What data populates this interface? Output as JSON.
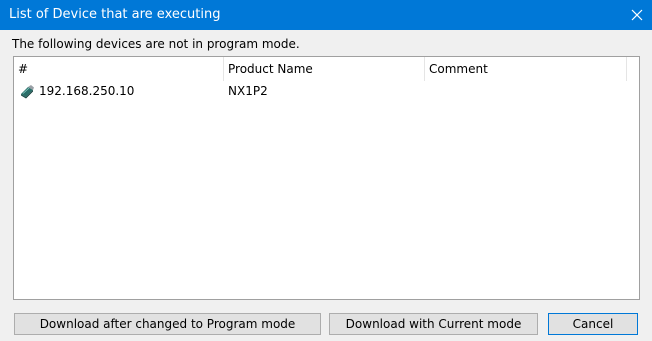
{
  "window": {
    "title": "List of Device that are executing",
    "close_icon": "close-icon"
  },
  "message": "The following devices are not in program mode.",
  "list": {
    "columns": [
      "#",
      "Product Name",
      "Comment"
    ],
    "rows": [
      {
        "icon": "device-icon",
        "address": "192.168.250.10",
        "product_name": "NX1P2",
        "comment": ""
      }
    ]
  },
  "buttons": {
    "download_program_mode": "Download after changed to Program mode",
    "download_current_mode": "Download with Current mode",
    "cancel": "Cancel"
  },
  "colors": {
    "titlebar": "#0078d7",
    "background": "#f0f0f0"
  }
}
